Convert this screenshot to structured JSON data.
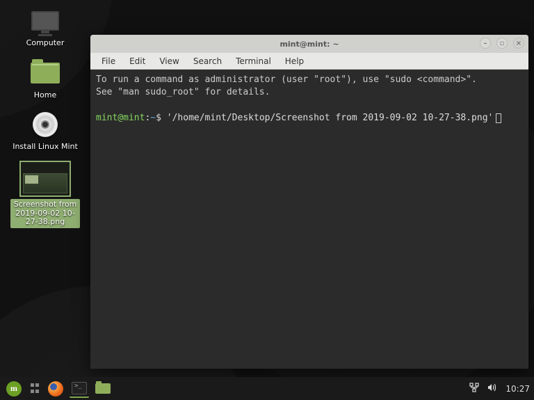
{
  "desktop": {
    "icons": {
      "computer": "Computer",
      "home": "Home",
      "install": "Install Linux Mint",
      "screenshot": "Screenshot from 2019-09-02 10-27-38.png"
    }
  },
  "window": {
    "title": "mint@mint: ~",
    "menu": {
      "file": "File",
      "edit": "Edit",
      "view": "View",
      "search": "Search",
      "terminal": "Terminal",
      "help": "Help"
    },
    "controls": {
      "minimize": "–",
      "maximize": "▫",
      "close": "×"
    },
    "terminal": {
      "motd_line1": "To run a command as administrator (user \"root\"), use \"sudo <command>\".",
      "motd_line2": "See \"man sudo_root\" for details.",
      "prompt_userhost": "mint@mint",
      "prompt_sep": ":",
      "prompt_path": "~",
      "prompt_dollar": "$",
      "command": "'/home/mint/Desktop/Screenshot from 2019-09-02 10-27-38.png'"
    }
  },
  "taskbar": {
    "clock": "10:27"
  }
}
